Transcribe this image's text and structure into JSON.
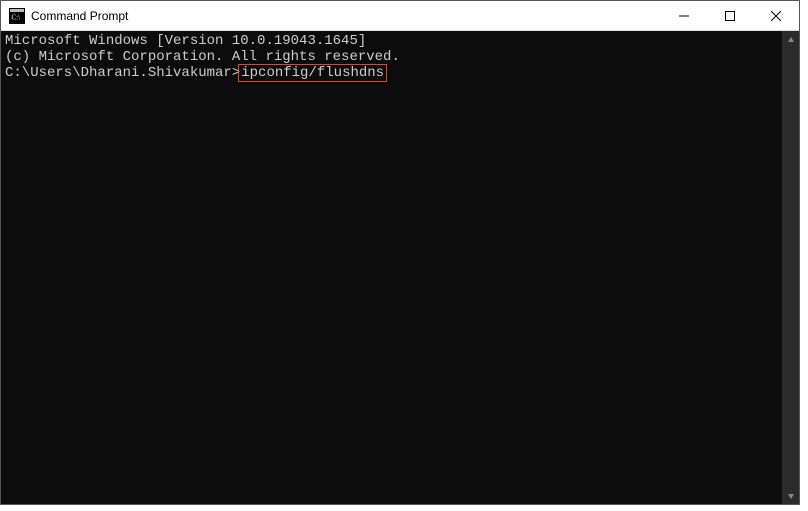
{
  "titlebar": {
    "title": "Command Prompt"
  },
  "terminal": {
    "line1": "Microsoft Windows [Version 10.0.19043.1645]",
    "line2": "(c) Microsoft Corporation. All rights reserved.",
    "blank": "",
    "prompt": "C:\\Users\\Dharani.Shivakumar>",
    "command": "ipconfig/flushdns"
  }
}
